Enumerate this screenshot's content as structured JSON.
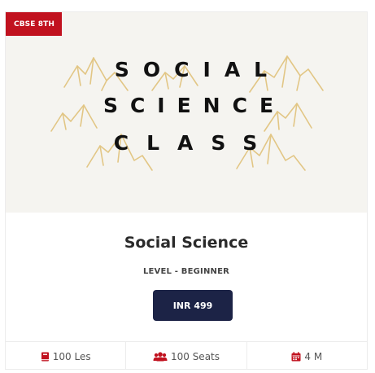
{
  "card": {
    "badge": "CBSE 8TH",
    "banner": {
      "line1": "SOCIAL",
      "line2": "SCIENCE",
      "line3": "CLASS"
    },
    "title": "Social Science",
    "level": "LEVEL - BEGINNER",
    "price_label": "INR 499",
    "stats": {
      "lessons": "100 Les",
      "seats": "100 Seats",
      "duration": "4 M"
    },
    "icons": {
      "lessons": "book-icon",
      "seats": "users-icon",
      "duration": "calendar-icon"
    }
  },
  "colors": {
    "badge": "#c1121f",
    "button": "#1c2346",
    "icon": "#c1121f",
    "banner_bg": "#f5f4f0",
    "banner_art": "#e0c27a"
  }
}
